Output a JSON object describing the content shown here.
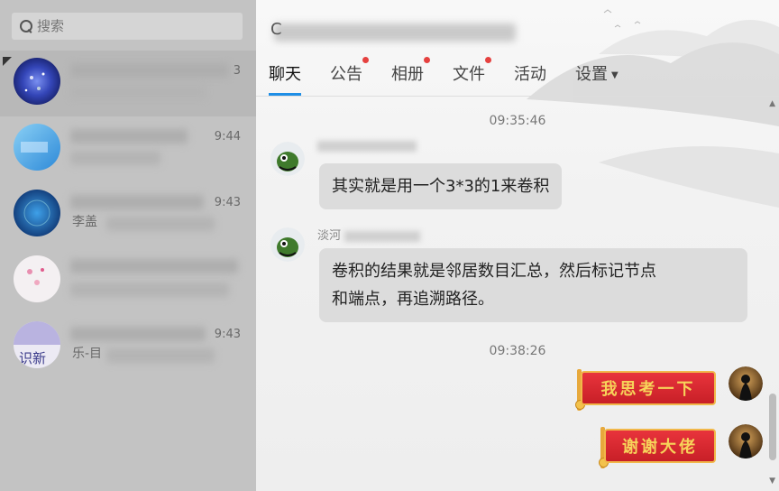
{
  "search": {
    "placeholder": "搜索"
  },
  "conversations": [
    {
      "time": "3",
      "preview": ""
    },
    {
      "time": "9:44",
      "preview": ""
    },
    {
      "time": "9:43",
      "preview": "李盖"
    },
    {
      "time": "",
      "preview": ""
    },
    {
      "time": "9:43",
      "preview": "乐-目"
    }
  ],
  "chat": {
    "title": "C",
    "tabs": [
      {
        "label": "聊天"
      },
      {
        "label": "公告"
      },
      {
        "label": "相册"
      },
      {
        "label": "文件"
      },
      {
        "label": "活动"
      },
      {
        "label": "设置"
      }
    ],
    "messages": {
      "ts1": "09:35:46",
      "msg1_text": "其实就是用一个3*3的1来卷积",
      "msg2_sender": "淡河",
      "msg2_line1": "卷积的结果就是邻居数目汇总，然后标记节点",
      "msg2_line2": "和端点，再追溯路径。",
      "ts2": "09:38:26",
      "sticker1": "我思考一下",
      "sticker2": "谢谢大佬"
    }
  },
  "colors": {
    "accent": "#1e8ee6",
    "badge": "#e5413f",
    "bubble": "#dcdcdc",
    "sidebar": "#c3c3c3",
    "sticker": "#d9262e"
  }
}
